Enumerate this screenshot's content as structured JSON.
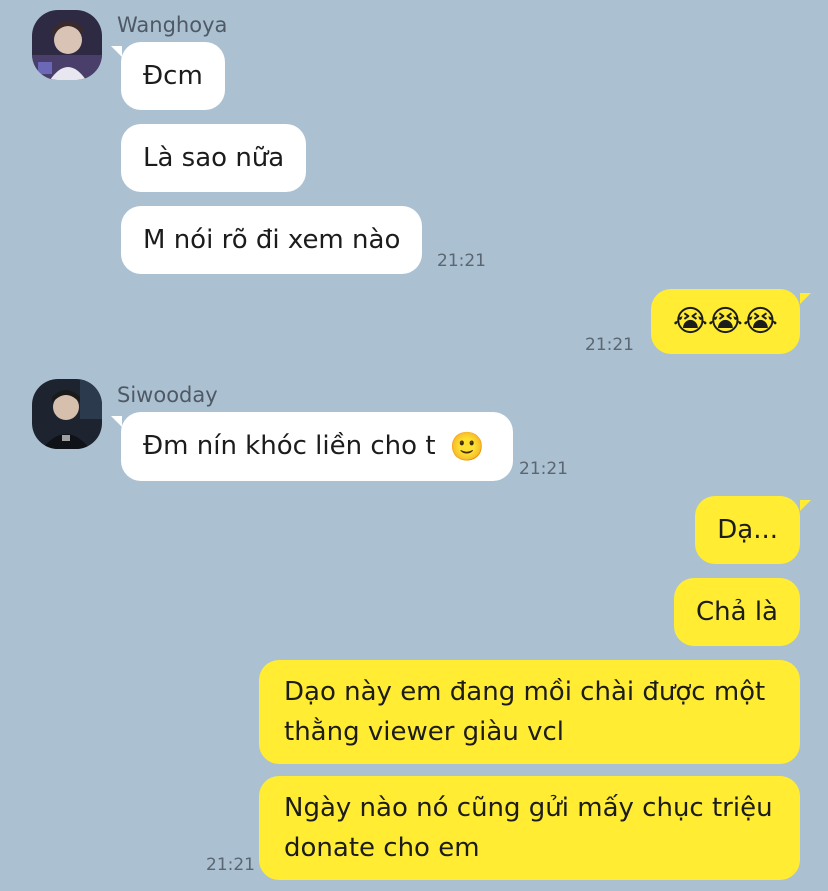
{
  "conversation": {
    "group1": {
      "sender": "Wanghoya",
      "messages": [
        "Đcm",
        "Là sao nữa",
        "M nói rõ đi xem nào"
      ],
      "time": "21:21"
    },
    "mine1": {
      "emoji": "😭😭😭",
      "time": "21:21"
    },
    "group2": {
      "sender": "Siwooday",
      "message": "Đm nín khóc liền cho t",
      "emoji": "🙂",
      "time": "21:21"
    },
    "mine2": {
      "messages": [
        "Dạ...",
        "Chả là",
        "Dạo này em đang mồi chài được một thằng viewer giàu vcl",
        "Ngày nào nó cũng gửi mấy chục triệu donate cho em"
      ],
      "time": "21:21"
    }
  },
  "colors": {
    "background": "#abc1d1",
    "incoming_bubble": "#ffffff",
    "outgoing_bubble": "#ffec33"
  }
}
